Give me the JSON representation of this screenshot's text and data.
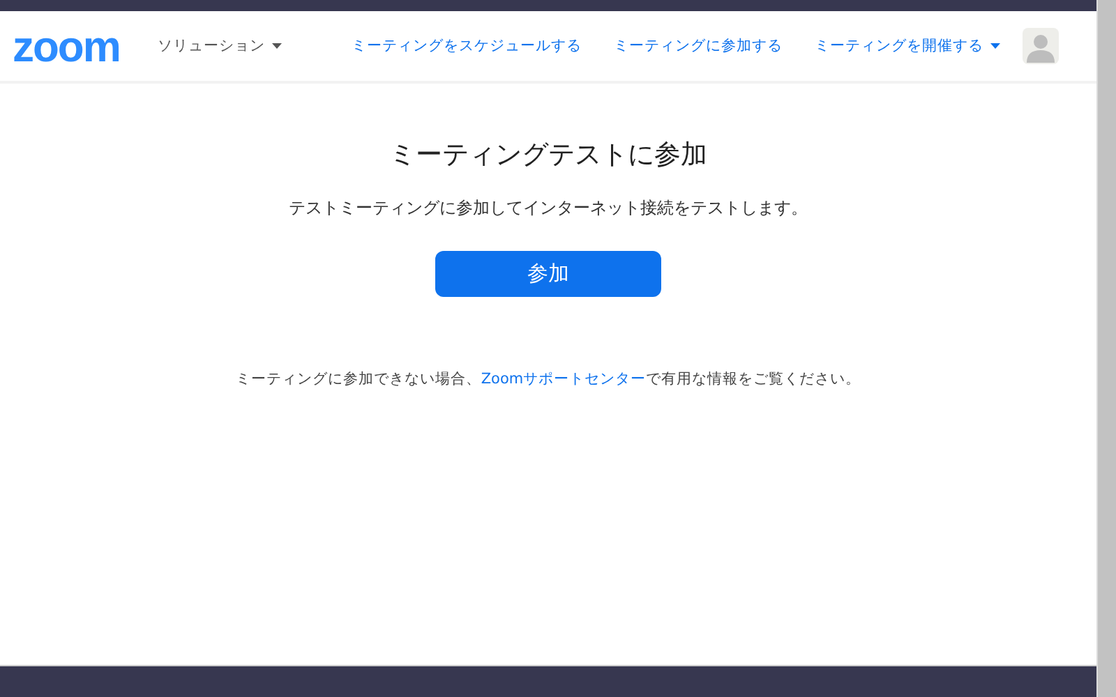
{
  "header": {
    "logo": "zoom",
    "solutions_menu": {
      "label": "ソリューション",
      "has_dropdown": true
    },
    "nav_links": [
      {
        "label": "ミーティングをスケジュールする",
        "has_dropdown": false
      },
      {
        "label": "ミーティングに参加する",
        "has_dropdown": false
      },
      {
        "label": "ミーティングを開催する",
        "has_dropdown": true
      }
    ]
  },
  "main": {
    "title": "ミーティングテストに参加",
    "description": "テストミーティングに参加してインターネット接続をテストします。",
    "join_button": "参加",
    "help": {
      "before": "ミーティングに参加できない場合、",
      "link": "Zoomサポートセンター",
      "after": "で有用な情報をご覧ください。"
    }
  }
}
